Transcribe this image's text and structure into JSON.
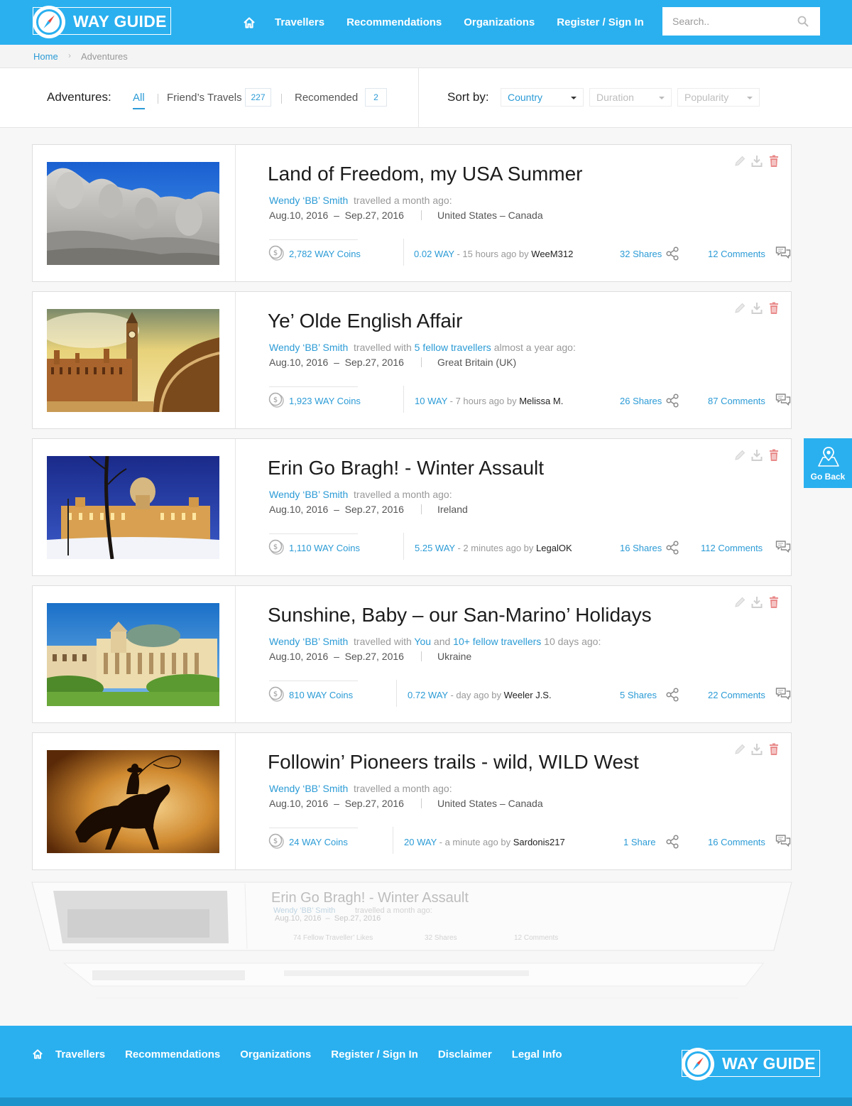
{
  "header": {
    "logo_text": "WAY GUIDE",
    "nav": [
      "Travellers",
      "Recommendations",
      "Organizations",
      "Register / Sign In"
    ],
    "search_placeholder": "Search.."
  },
  "breadcrumb": {
    "home": "Home",
    "current": "Adventures"
  },
  "filters": {
    "label": "Adventures:",
    "tabs": [
      {
        "label": "All",
        "active": true
      },
      {
        "label": "Friend’s Travels",
        "count": "227"
      },
      {
        "label": "Recomended",
        "count": "2"
      }
    ],
    "sort_label": "Sort by:",
    "sort_options": [
      "Country",
      "Duration",
      "Popularity"
    ]
  },
  "adventures": [
    {
      "title": "Land of Freedom, my USA Summer",
      "author": "Wendy ‘BB’ Smith",
      "meta_mid": "travelled a month ago:",
      "date_start": "Aug.10, 2016",
      "date_end": "Sep.27, 2016",
      "location": "United States – Canada",
      "coins": "2,782 WAY Coins",
      "way": "0.02 WAY",
      "ago": "- 15 hours ago by",
      "by": "WeeM312",
      "shares": "32 Shares",
      "comments": "12 Comments",
      "image": "mount-rushmore"
    },
    {
      "title": "Ye’ Olde English Affair",
      "author": "Wendy ‘BB’ Smith",
      "meta_mid": "travelled with",
      "meta_link": "5 fellow travellers",
      "meta_end": "almost a year ago:",
      "date_start": "Aug.10, 2016",
      "date_end": "Sep.27, 2016",
      "location": "Great Britain (UK)",
      "coins": "1,923 WAY Coins",
      "way": "10 WAY",
      "ago": "- 7 hours ago by",
      "by": "Melissa M.",
      "shares": "26 Shares",
      "comments": "87 Comments",
      "image": "big-ben"
    },
    {
      "title": "Erin Go Bragh! - Winter Assault",
      "author": "Wendy ‘BB’ Smith",
      "meta_mid": "travelled a month ago:",
      "date_start": "Aug.10, 2016",
      "date_end": "Sep.27, 2016",
      "location": "Ireland",
      "coins": "1,110 WAY Coins",
      "way": "5.25 WAY",
      "ago": "- 2 minutes ago by",
      "by": "LegalOK",
      "shares": "16 Shares",
      "comments": "112 Comments",
      "image": "belfast-winter"
    },
    {
      "title": "Sunshine, Baby – our San-Marino’ Holidays",
      "author": "Wendy ‘BB’ Smith",
      "meta_mid": "travelled with",
      "meta_you": "You",
      "meta_and": "and",
      "meta_link": "10+ fellow travellers",
      "meta_end": "10 days ago:",
      "date_start": "Aug.10, 2016",
      "date_end": "Sep.27, 2016",
      "location": "Ukraine",
      "coins": "810 WAY Coins",
      "way": "0.72 WAY",
      "ago": "- day ago by",
      "by": "Weeler J.S.",
      "shares": "5 Shares",
      "comments": "22 Comments",
      "image": "opera-house"
    },
    {
      "title": "Followin’ Pioneers trails - wild, WILD West",
      "author": "Wendy ‘BB’ Smith",
      "meta_mid": "travelled a month ago:",
      "date_start": "Aug.10, 2016",
      "date_end": "Sep.27, 2016",
      "location": "United States – Canada",
      "coins": "24 WAY Coins",
      "way": "20 WAY",
      "ago": "- a minute ago by",
      "by": "Sardonis217",
      "shares": "1 Share",
      "comments": "16 Comments",
      "image": "cowboy"
    }
  ],
  "ghost_card": {
    "title": "Erin Go Bragh! - Winter Assault",
    "author": "Wendy ‘BB’ Smith",
    "meta": "travelled a month ago:",
    "dates": "Aug.10, 2016  –  Sep.27, 2016",
    "likes": "74 Fellow Traveller’ Likes",
    "shares": "32 Shares",
    "comments": "12 Comments"
  },
  "go_back": "Go Back",
  "footer": {
    "nav": [
      "Travellers",
      "Recommendations",
      "Organizations",
      "Register / Sign In",
      "Disclaimer",
      "Legal Info"
    ],
    "logo_text": "WAY GUIDE"
  },
  "colors": {
    "brand": "#2ab0ef",
    "link": "#2b9bd6",
    "delete": "#e05a5a"
  }
}
